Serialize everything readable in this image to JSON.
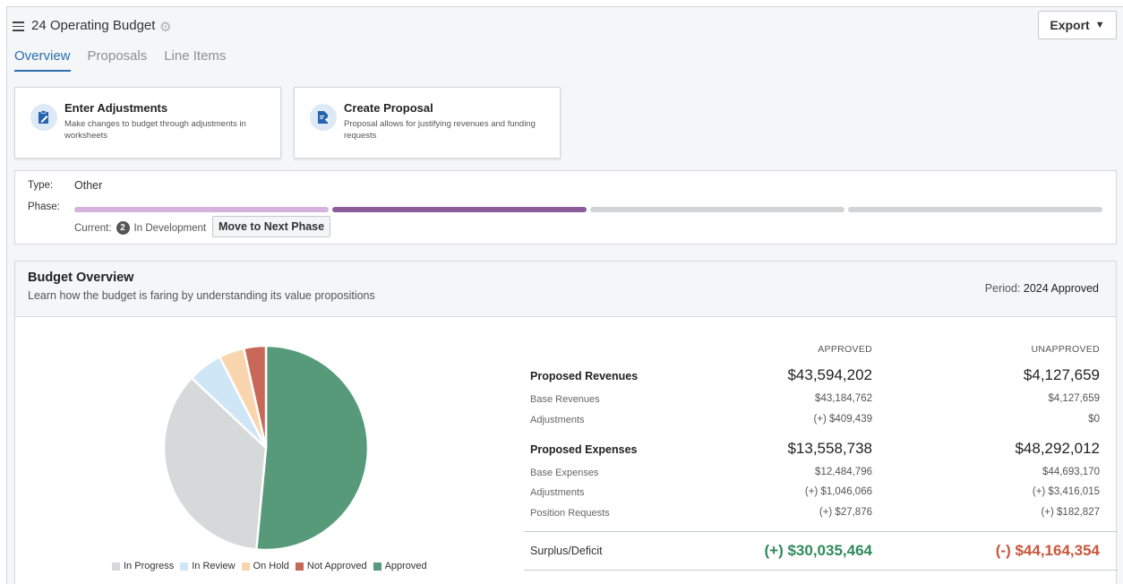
{
  "header": {
    "title": "24 Operating Budget",
    "export_label": "Export",
    "tabs": [
      {
        "label": "Overview",
        "active": true
      },
      {
        "label": "Proposals",
        "active": false
      },
      {
        "label": "Line Items",
        "active": false
      }
    ]
  },
  "actions": [
    {
      "title": "Enter Adjustments",
      "description": "Make changes to budget through adjustments in worksheets",
      "icon": "clipboard-edit-icon"
    },
    {
      "title": "Create Proposal",
      "description": "Proposal allows for justifying revenues and funding requests",
      "icon": "document-add-icon"
    }
  ],
  "phase": {
    "type_label": "Type:",
    "type_value": "Other",
    "phase_label": "Phase:",
    "current_label": "Current:",
    "current_number": "2",
    "current_name": "In Development",
    "next_button": "Move to Next Phase",
    "segment_colors": [
      "#d3b3de",
      "#8b5c99",
      "#d0d4d6",
      "#d0d4d6"
    ]
  },
  "overview": {
    "title": "Budget Overview",
    "subtitle": "Learn how the budget is faring by understanding its value propositions",
    "period_label": "Period:",
    "period_value": "2024 Approved",
    "col_approved": "APPROVED",
    "col_unapproved": "UNAPPROVED",
    "rows": [
      {
        "label": "Proposed Revenues",
        "kind": "major",
        "approved": "$43,594,202",
        "unapproved": "$4,127,659"
      },
      {
        "label": "Base Revenues",
        "kind": "minor",
        "approved": "$43,184,762",
        "unapproved": "$4,127,659"
      },
      {
        "label": "Adjustments",
        "kind": "minor",
        "approved": "(+) $409,439",
        "unapproved": "$0"
      },
      {
        "label": "Proposed Expenses",
        "kind": "major",
        "approved": "$13,558,738",
        "unapproved": "$48,292,012"
      },
      {
        "label": "Base Expenses",
        "kind": "minor",
        "approved": "$12,484,796",
        "unapproved": "$44,693,170"
      },
      {
        "label": "Adjustments",
        "kind": "minor",
        "approved": "(+) $1,046,066",
        "unapproved": "(+) $3,416,015"
      },
      {
        "label": "Position Requests",
        "kind": "minor",
        "approved": "(+) $27,876",
        "unapproved": "(+) $182,827"
      }
    ],
    "surplus": {
      "label": "Surplus/Deficit",
      "approved": "(+) $30,035,464",
      "unapproved": "(-) $44,164,354"
    },
    "colors": {
      "positive": "#2e8a5b",
      "negative": "#c9563c"
    }
  },
  "chart_data": {
    "type": "pie",
    "title": "",
    "slices": [
      {
        "name": "Approved",
        "value": 51.5,
        "color": "#579a7a"
      },
      {
        "name": "In Progress",
        "value": 35.5,
        "color": "#d5d9da"
      },
      {
        "name": "In Review",
        "value": 5.5,
        "color": "#cfe6f7"
      },
      {
        "name": "On Hold",
        "value": 4,
        "color": "#f9d5ae"
      },
      {
        "name": "Not Approved",
        "value": 3.5,
        "color": "#c86856"
      }
    ],
    "legend": [
      "In Progress",
      "In Review",
      "On Hold",
      "Not Approved",
      "Approved"
    ],
    "legend_position": "bottom"
  }
}
